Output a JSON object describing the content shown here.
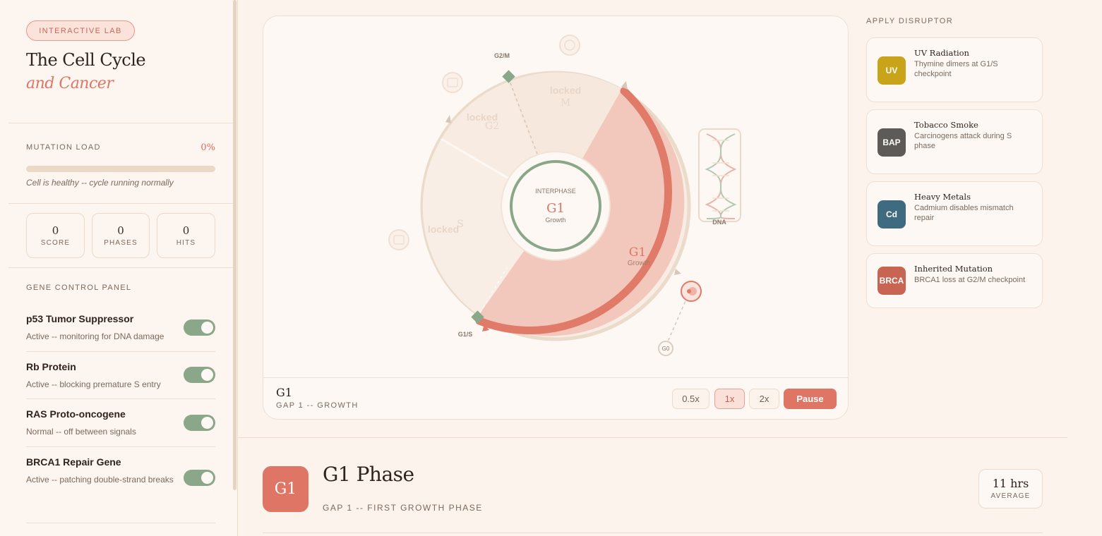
{
  "sidebar": {
    "lab_pill": "INTERACTIVE LAB",
    "title_line1": "The Cell Cycle",
    "title_line2": "and Cancer",
    "mutation": {
      "label": "MUTATION LOAD",
      "value": "0%",
      "fraction": 0,
      "status": "Cell is healthy -- cycle running normally"
    },
    "stats": [
      {
        "value": "0",
        "label": "SCORE"
      },
      {
        "value": "0",
        "label": "PHASES"
      },
      {
        "value": "0",
        "label": "HITS"
      }
    ],
    "gene_panel": {
      "heading": "GENE CONTROL PANEL",
      "genes": [
        {
          "name": "p53 Tumor Suppressor",
          "desc": "Active -- monitoring for DNA damage",
          "on": true
        },
        {
          "name": "Rb Protein",
          "desc": "Active -- blocking premature S entry",
          "on": true
        },
        {
          "name": "RAS Proto-oncogene",
          "desc": "Normal -- off between signals",
          "on": true
        },
        {
          "name": "BRCA1 Repair Gene",
          "desc": "Active -- patching double-strand breaks",
          "on": true
        }
      ]
    }
  },
  "wheel": {
    "center": {
      "label": "INTERPHASE",
      "phase": "G1",
      "sub": "Growth"
    },
    "g1": {
      "name": "G1",
      "sub": "Growth"
    },
    "m": {
      "locked": "locked",
      "name": "M"
    },
    "g2": {
      "locked": "locked",
      "name": "G2"
    },
    "s": {
      "locked": "locked",
      "name": "S"
    },
    "checkpoints": {
      "g2m": "G2/M",
      "g1s": "G1/S",
      "g0": "G0"
    },
    "dna_label": "DNA"
  },
  "footer": {
    "phase": "G1",
    "sub": "GAP 1 -- GROWTH",
    "speeds": [
      "0.5x",
      "1x",
      "2x"
    ],
    "active_speed": "1x",
    "pause_label": "Pause"
  },
  "disruptors": {
    "heading": "APPLY DISRUPTOR",
    "items": [
      {
        "badge": "UV",
        "name": "UV Radiation",
        "desc": "Thymine dimers at G1/S checkpoint",
        "color": "#c9a319"
      },
      {
        "badge": "BAP",
        "name": "Tobacco Smoke",
        "desc": "Carcinogens attack during S phase",
        "color": "#5e5a57"
      },
      {
        "badge": "Cd",
        "name": "Heavy Metals",
        "desc": "Cadmium disables mismatch repair",
        "color": "#3e6b80"
      },
      {
        "badge": "BRCA",
        "name": "Inherited Mutation",
        "desc": "BRCA1 loss at G2/M checkpoint",
        "color": "#c86552"
      }
    ]
  },
  "phase_detail": {
    "badge": "G1",
    "title": "G1 Phase",
    "subtitle": "GAP 1 -- FIRST GROWTH PHASE",
    "duration": "11 hrs",
    "duration_label": "AVERAGE"
  }
}
